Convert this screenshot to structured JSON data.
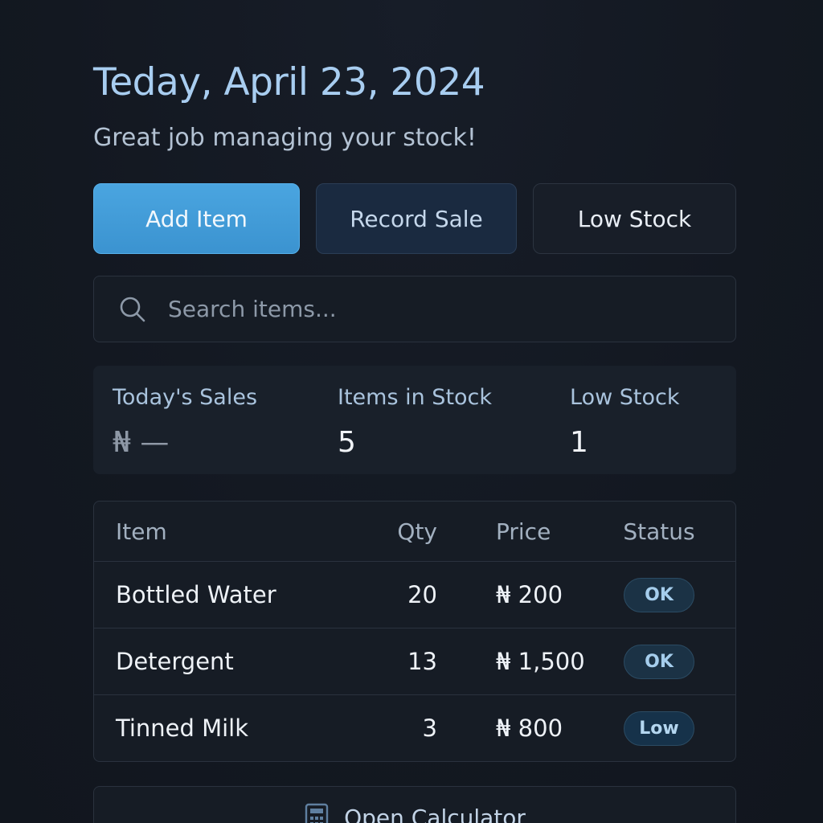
{
  "header": {
    "date_title": "Teday, April 23, 2024",
    "subtitle": "Great job managing your stock!"
  },
  "actions": {
    "add_item": "Add Item",
    "record_sale": "Record Sale",
    "low_stock": "Low Stock"
  },
  "search": {
    "icon": "search-icon",
    "placeholder": "Search items..."
  },
  "stats": [
    {
      "label": "Today's Sales",
      "value": "₦ —"
    },
    {
      "label": "Items in Stock",
      "value": "5"
    },
    {
      "label": "Low Stock",
      "value": "1"
    }
  ],
  "table": {
    "columns": [
      "Item",
      "Qty",
      "Price",
      "Status"
    ],
    "rows": [
      {
        "item": "Bottled Water",
        "qty": "20",
        "price": "₦ 200",
        "status": "OK"
      },
      {
        "item": "Detergent",
        "qty": "13",
        "price": "₦ 1,500",
        "status": "OK"
      },
      {
        "item": "Tinned Milk",
        "qty": "3",
        "price": "₦ 800",
        "status": "Low"
      }
    ]
  },
  "calculator": {
    "icon": "calculator-icon",
    "label": "Open Calculator"
  },
  "colors": {
    "background": "#131821",
    "accent": "#3b93d0",
    "title": "#a8cdf0",
    "badge_bg": "#1b3245"
  }
}
